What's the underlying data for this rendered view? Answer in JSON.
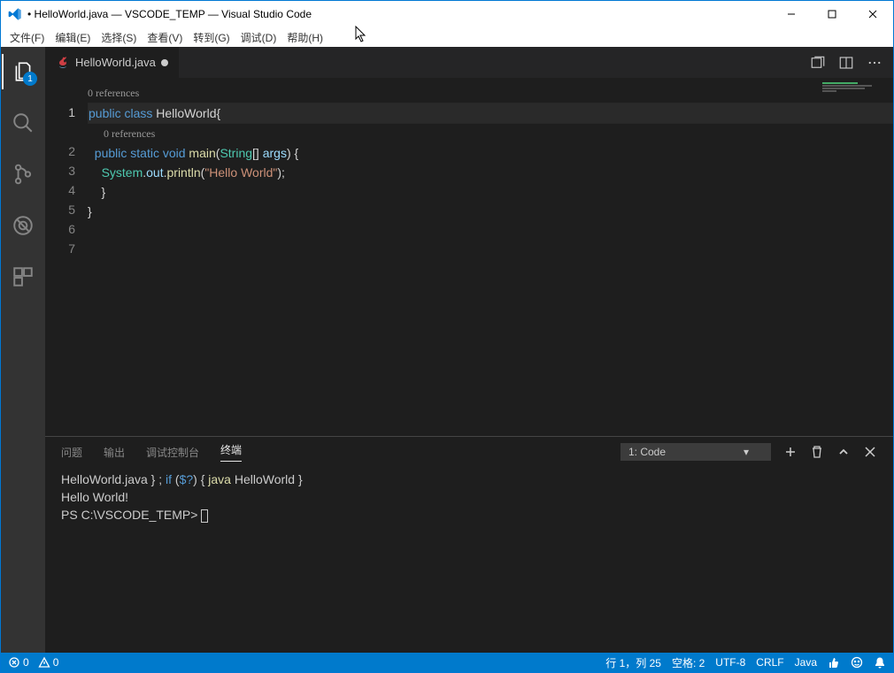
{
  "window": {
    "title": "• HelloWorld.java — VSCODE_TEMP — Visual Studio Code"
  },
  "menu": {
    "file": "文件(F)",
    "edit": "编辑(E)",
    "select": "选择(S)",
    "view": "查看(V)",
    "goto": "转到(G)",
    "debug": "调试(D)",
    "help": "帮助(H)"
  },
  "activity": {
    "explorer_badge": "1"
  },
  "tab": {
    "filename": "HelloWorld.java"
  },
  "editor": {
    "codelens1": "0 references",
    "codelens2": "0 references",
    "lines": {
      "l1": {
        "public": "public",
        "class": "class",
        "name": "HelloWorld",
        "brace": "{"
      },
      "l2": {
        "public": "public",
        "static": "static",
        "void": "void",
        "main": "main",
        "sig_open": "(",
        "type": "String",
        "arr": "[] ",
        "arg": "args",
        "sig_close": ") {"
      },
      "l3": {
        "sys": "System",
        "dot1": ".",
        "out": "out",
        "dot2": ".",
        "println": "println",
        "open": "(",
        "str": "\"Hello World\"",
        "close": ");"
      },
      "l4": "    }",
      "l5": "}"
    },
    "line_numbers": [
      "1",
      "2",
      "3",
      "4",
      "5",
      "6",
      "7"
    ]
  },
  "panel": {
    "tabs": {
      "problems": "问题",
      "output": "输出",
      "debug": "调试控制台",
      "terminal": "终端"
    },
    "selector": "1: Code",
    "terminal": {
      "line1_a": " HelloWorld.java } ; ",
      "line1_if": "if",
      "line1_b": " (",
      "line1_var": "$?",
      "line1_c": ") { ",
      "line1_cmd": "java",
      "line1_d": " HelloWorld }",
      "line2": "Hello World!",
      "line3": "PS C:\\VSCODE_TEMP> "
    }
  },
  "status": {
    "errors": "0",
    "warnings": "0",
    "ln_col": "行 1，列 25",
    "spaces": "空格: 2",
    "encoding": "UTF-8",
    "eol": "CRLF",
    "lang": "Java"
  }
}
